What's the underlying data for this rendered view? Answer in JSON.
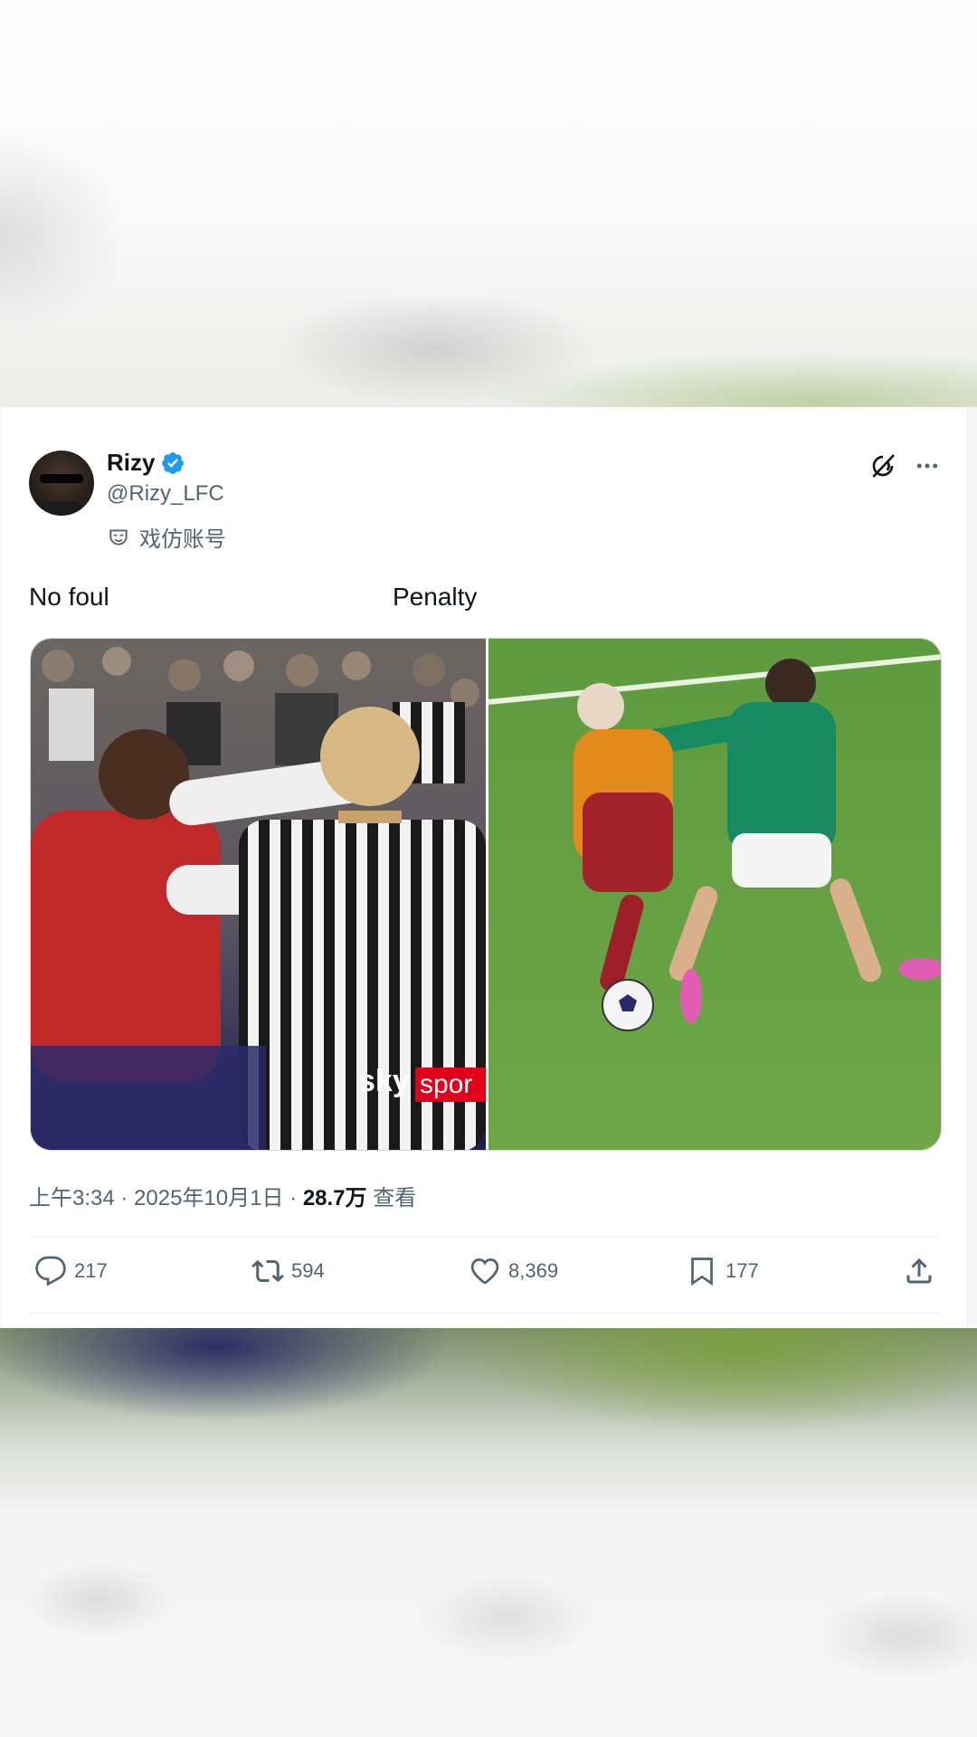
{
  "tweet": {
    "author": {
      "name": "Rizy",
      "handle": "@Rizy_LFC",
      "parody_label": "戏仿账号",
      "verified_color": "#1d9bf0"
    },
    "captions": {
      "left": "No foul",
      "right": "Penalty"
    },
    "media": {
      "left_overlay_text_sky": "sky",
      "left_overlay_text_sports": "spor"
    },
    "meta": {
      "time_date": "上午3:34 · 2025年10月1日 · ",
      "views_count": "28.7万",
      "views_label": " 查看"
    },
    "actions": {
      "replies": "217",
      "reposts": "594",
      "likes": "8,369",
      "bookmarks": "177"
    },
    "icons": {
      "reply": "reply-icon",
      "repost": "repost-icon",
      "like": "like-icon",
      "bookmark": "bookmark-icon",
      "share": "share-icon",
      "grok": "grok-icon",
      "more": "more-icon"
    }
  }
}
